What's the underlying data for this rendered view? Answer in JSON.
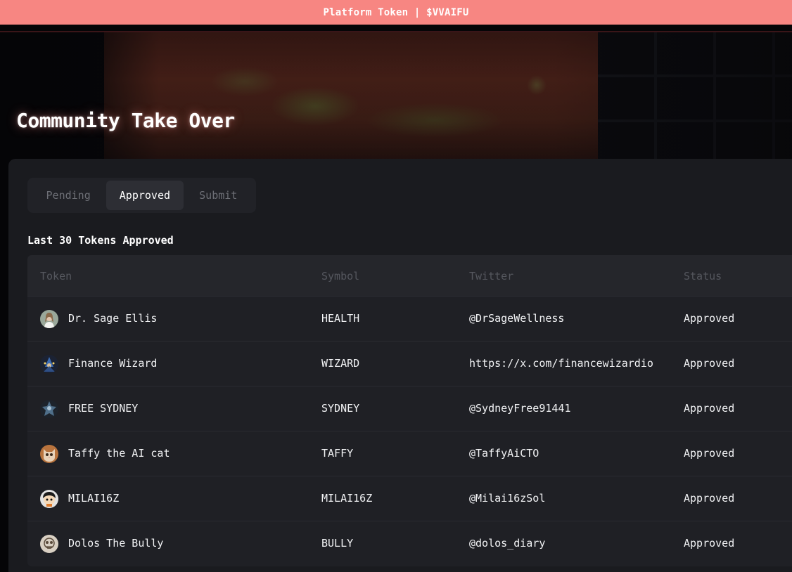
{
  "banner": {
    "text": "Platform Token | $VVAIFU"
  },
  "hero": {
    "title": "Community Take Over"
  },
  "tabs": [
    {
      "label": "Pending",
      "active": false
    },
    {
      "label": "Approved",
      "active": true
    },
    {
      "label": "Submit",
      "active": false
    }
  ],
  "section": {
    "heading": "Last 30 Tokens Approved"
  },
  "table": {
    "columns": [
      "Token",
      "Symbol",
      "Twitter",
      "Status"
    ],
    "rows": [
      {
        "name": "Dr. Sage Ellis",
        "symbol": "HEALTH",
        "twitter": "@DrSageWellness",
        "status": "Approved",
        "avatar_icon": "woman-portrait-icon",
        "avatar_color": "#9aa89a"
      },
      {
        "name": "Finance Wizard",
        "symbol": "WIZARD",
        "twitter": "https://x.com/financewizardio",
        "status": "Approved",
        "avatar_icon": "wizard-icon",
        "avatar_color": "#2e4f86"
      },
      {
        "name": "FREE SYDNEY",
        "symbol": "SYDNEY",
        "twitter": "@SydneyFree91441",
        "status": "Approved",
        "avatar_icon": "robot-icon",
        "avatar_color": "#4f6f8a"
      },
      {
        "name": "Taffy the AI cat",
        "symbol": "TAFFY",
        "twitter": "@TaffyAiCTO",
        "status": "Approved",
        "avatar_icon": "cat-icon",
        "avatar_color": "#b8733d"
      },
      {
        "name": "MILAI16Z",
        "symbol": "MILAI16Z",
        "twitter": "@Milai16zSol",
        "status": "Approved",
        "avatar_icon": "cartoon-face-icon",
        "avatar_color": "#e2e2e2"
      },
      {
        "name": "Dolos The Bully",
        "symbol": "BULLY",
        "twitter": "@dolos_diary",
        "status": "Approved",
        "avatar_icon": "skull-sketch-icon",
        "avatar_color": "#d8cfc2"
      }
    ]
  },
  "colors": {
    "banner": "#f78682",
    "background": "#050507",
    "panel": "#1a1b1f",
    "table_header": "#25262b",
    "active_tab": "#2d2e34"
  }
}
